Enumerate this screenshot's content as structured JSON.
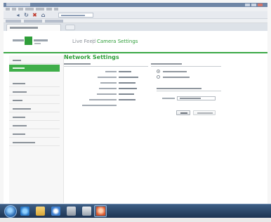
{
  "browser": {
    "window_title": "",
    "menu_items": [],
    "address_url": "",
    "favorites": [],
    "tab_title": ""
  },
  "app": {
    "top_tabs": [
      "Live Feed",
      "Camera Settings"
    ],
    "tab_separator": "|",
    "active_tab": "Camera Settings",
    "accent_color": "#3fae49",
    "sidebar_items": [
      "",
      "",
      "",
      "",
      "",
      "",
      "",
      "",
      "",
      "",
      "",
      ""
    ],
    "sidebar_active_index": 1
  },
  "main": {
    "title": "Network Settings",
    "current_settings": {
      "heading": "",
      "rows": [
        {
          "label": "",
          "value": ""
        },
        {
          "label": "",
          "value": ""
        },
        {
          "label": "",
          "value": ""
        },
        {
          "label": "",
          "value": ""
        },
        {
          "label": "",
          "value": ""
        },
        {
          "label": "",
          "value": ""
        },
        {
          "label": "",
          "value": ""
        }
      ]
    },
    "configuration_mode": {
      "heading": "",
      "options": [
        {
          "label": "",
          "selected": true
        },
        {
          "label": "",
          "selected": false
        }
      ]
    },
    "address_config": {
      "heading": "",
      "field_label": "",
      "field_value": ""
    },
    "buttons": {
      "cancel": "",
      "save": ""
    }
  },
  "taskbar": {
    "icons": [
      "start-orb",
      "internet-explorer-icon",
      "folder-icon",
      "media-player-icon",
      "app-icon",
      "app-icon",
      "app-icon"
    ]
  }
}
